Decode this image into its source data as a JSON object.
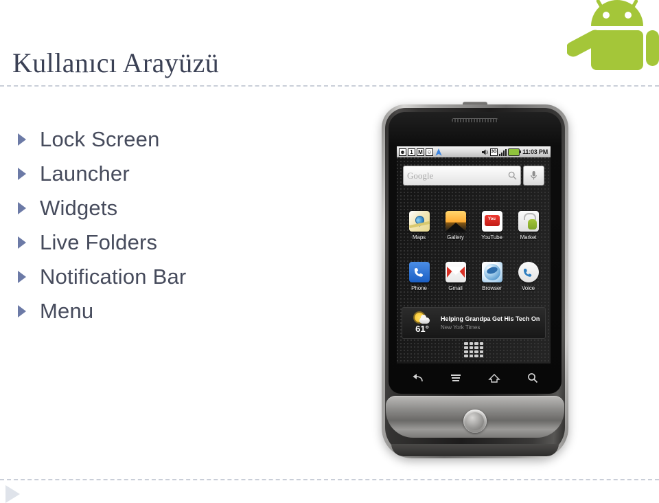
{
  "slide": {
    "title": "Kullanıcı Arayüzü",
    "accent_color": "#6c7aa6",
    "title_color": "#3b4155",
    "rule_color": "#c9ced8",
    "android_green": "#a4c639"
  },
  "bullets": [
    {
      "label": "Lock Screen"
    },
    {
      "label": "Launcher"
    },
    {
      "label": "Widgets"
    },
    {
      "label": "Live Folders"
    },
    {
      "label": "Notification Bar"
    },
    {
      "label": "Menu"
    }
  ],
  "phone": {
    "statusbar": {
      "icons_left": [
        "voicemail-icon",
        "calendar-icon",
        "gmail-icon",
        "sms-icon",
        "navigation-icon"
      ],
      "calendar_day": "1",
      "gmail_glyph": "M",
      "icons_right": [
        "ringer-icon",
        "data-3g-icon",
        "signal-icon",
        "battery-icon"
      ],
      "data_label": "3G",
      "clock": "11:03 PM"
    },
    "search_widget": {
      "placeholder": "Google",
      "search_icon": "search-icon",
      "mic_icon": "microphone-icon"
    },
    "apps_row1": [
      {
        "label": "Maps",
        "icon": "maps-icon"
      },
      {
        "label": "Gallery",
        "icon": "gallery-icon"
      },
      {
        "label": "YouTube",
        "icon": "youtube-icon"
      },
      {
        "label": "Market",
        "icon": "market-icon"
      }
    ],
    "apps_row2": [
      {
        "label": "Phone",
        "icon": "phone-icon"
      },
      {
        "label": "Gmail",
        "icon": "gmail-icon"
      },
      {
        "label": "Browser",
        "icon": "browser-icon"
      },
      {
        "label": "Voice",
        "icon": "voice-icon"
      }
    ],
    "youtube_badge": "You",
    "news_widget": {
      "temperature": "61°",
      "headline": "Helping Grandpa Get His Tech On",
      "source": "New York Times",
      "weather_icon": "sun-cloud-icon"
    },
    "drawer_handle": "app-drawer-icon",
    "softkeys": [
      "back-icon",
      "menu-icon",
      "home-icon",
      "search-icon"
    ]
  }
}
